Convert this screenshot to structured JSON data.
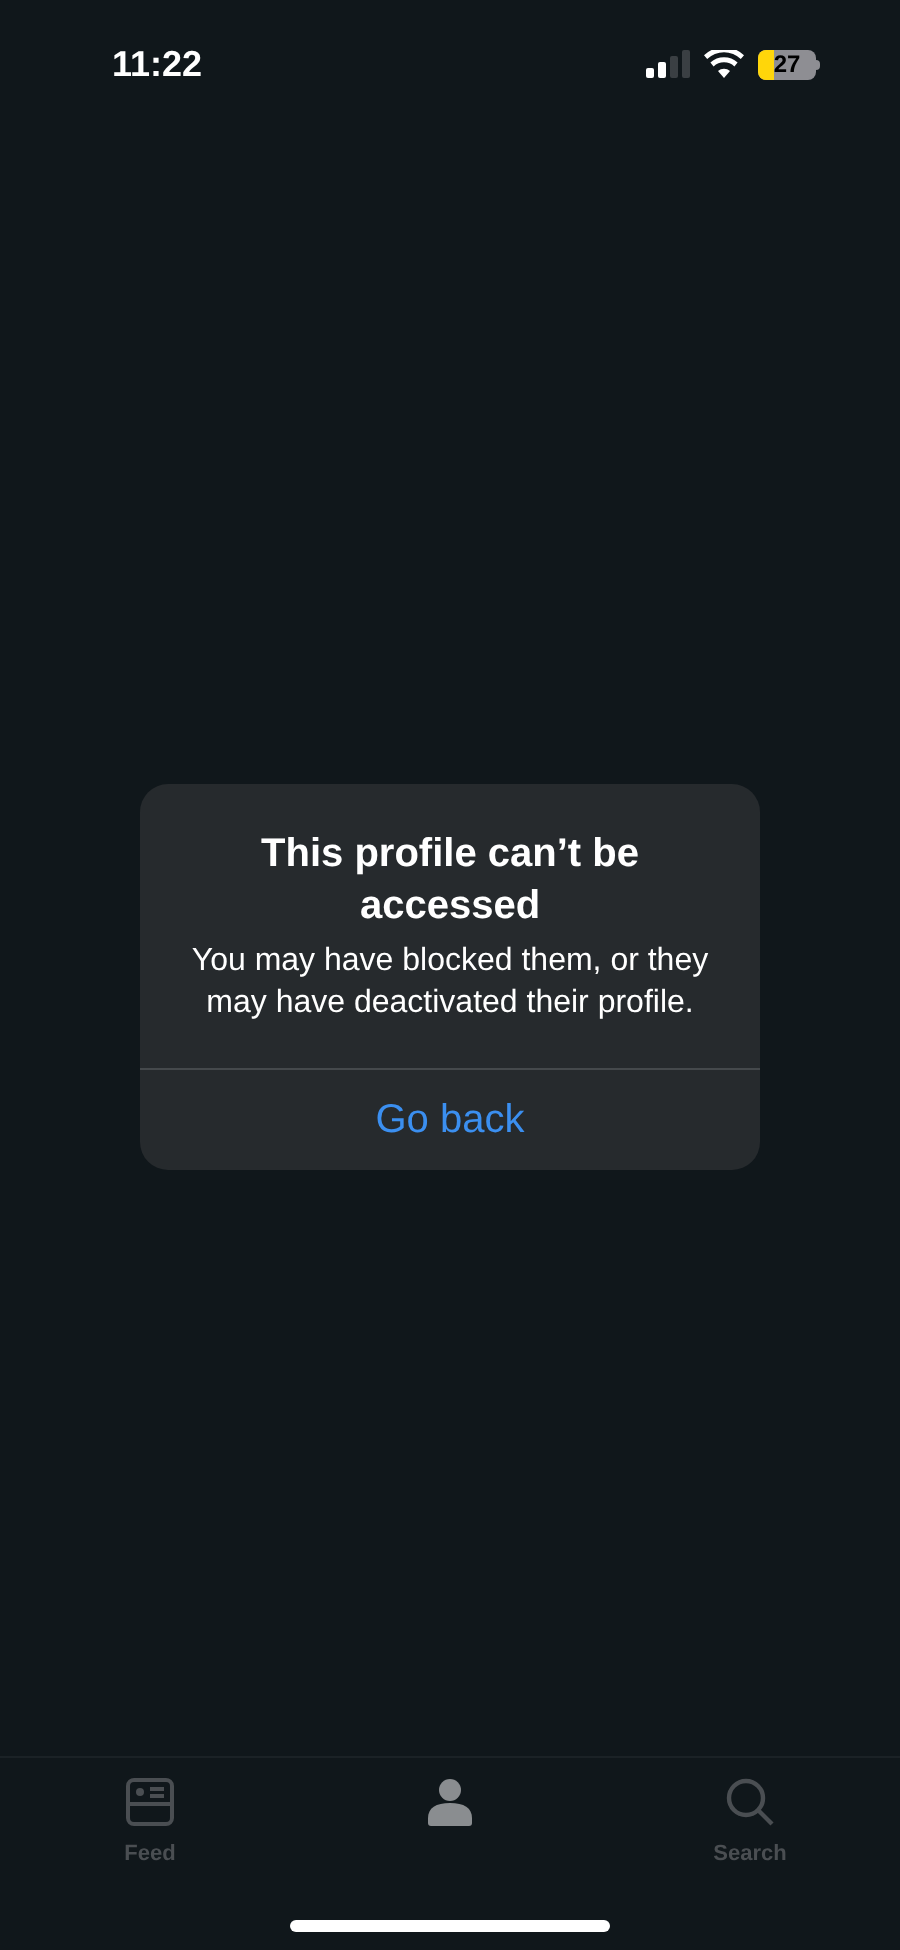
{
  "status_bar": {
    "time": "11:22",
    "battery": {
      "text": "27",
      "level": 0.27
    }
  },
  "dialog": {
    "title": "This profile can’t be accessed",
    "message": "You may have blocked them, or they may have deactivated their profile.",
    "button": "Go back"
  },
  "tabs": [
    {
      "kind": "feed",
      "label": "Feed",
      "selected": false
    },
    {
      "kind": "profile",
      "selected": true
    },
    {
      "kind": "search",
      "label": "Search",
      "selected": false
    }
  ]
}
